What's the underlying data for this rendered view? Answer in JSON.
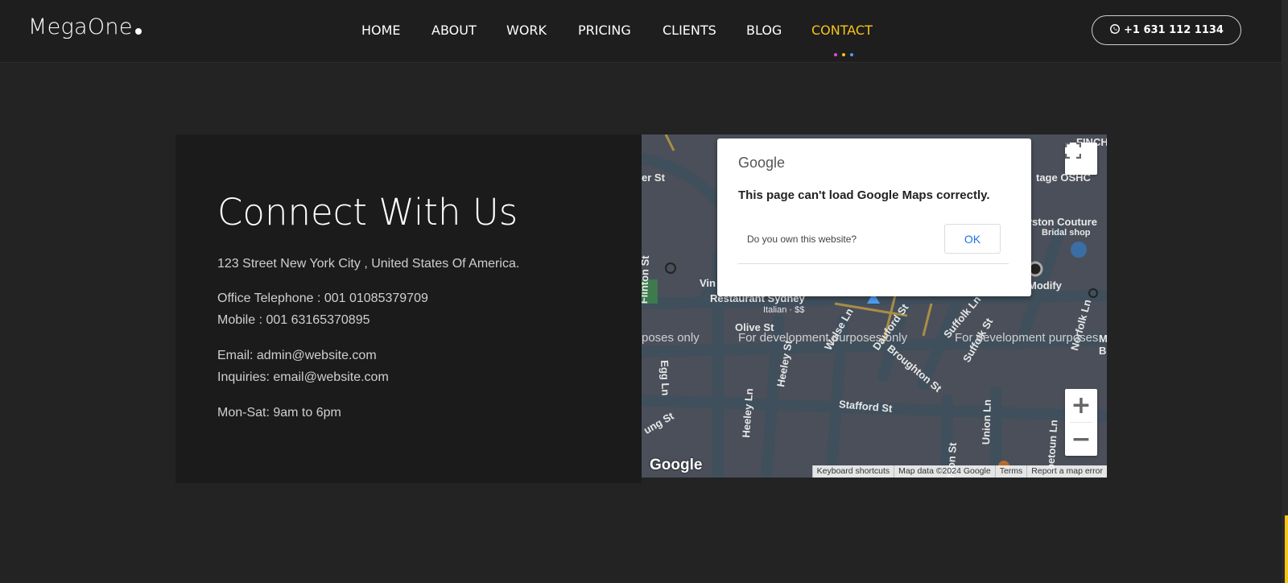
{
  "brand": {
    "name": "MegaOne"
  },
  "nav": {
    "items": [
      {
        "label": "HOME"
      },
      {
        "label": "ABOUT"
      },
      {
        "label": "WORK"
      },
      {
        "label": "PRICING"
      },
      {
        "label": "CLIENTS"
      },
      {
        "label": "BLOG"
      },
      {
        "label": "CONTACT",
        "active": true
      }
    ],
    "indicator_colors": [
      "#d94fd6",
      "#f5c518",
      "#4f9cf5"
    ]
  },
  "header": {
    "phone": "+1 631 112 1134",
    "phone_icon": "whatsapp-icon"
  },
  "contact": {
    "title": "Connect With Us",
    "address": "123 Street New York City , United States Of America.",
    "office_phone": "Office Telephone : 001 01085379709",
    "mobile": "Mobile : 001 63165370895",
    "email": "Email: admin@website.com",
    "inquiries": "Inquiries: email@website.com",
    "hours": "Mon-Sat: 9am to 6pm"
  },
  "map": {
    "dialog": {
      "brand": "Google",
      "message": "This page can't load Google Maps correctly.",
      "question": "Do you own this website?",
      "ok": "OK"
    },
    "labels": {
      "finch": "FINCH Syd",
      "tage": "tage OSHC",
      "couture": "rston Couture",
      "bridal": "Bridal shop",
      "modify": "Modify",
      "er_st": "er St",
      "vin": "Vin",
      "restaurant": "Restaurant Sydney",
      "italian": "Italian · $$",
      "olive": "Olive St",
      "flinton": "Flinton St",
      "egg": "Egg Ln",
      "heeley_st": "Heeley St",
      "heeley_ln": "Heeley Ln",
      "wolse": "Wolse Ln",
      "dauford": "Dauford St",
      "broughton": "Broughton St",
      "suffolk_ln": "Suffolk Ln",
      "suffolk_st": "Suffolk St",
      "norfolk": "Norfolk Ln",
      "stafford": "Stafford St",
      "union": "Union Ln",
      "ung": "ung St",
      "hion": "hion St",
      "ipetoun": "ipetoun Ln",
      "mc": "Mc Bl",
      "dev1": "poses only",
      "dev2": "For development purposes only",
      "dev3": "For development purposes"
    },
    "zoom_in": "+",
    "zoom_out": "−",
    "footer": {
      "shortcuts": "Keyboard shortcuts",
      "mapdata": "Map data ©2024 Google",
      "terms": "Terms",
      "report": "Report a map error"
    },
    "logo": "Google"
  }
}
